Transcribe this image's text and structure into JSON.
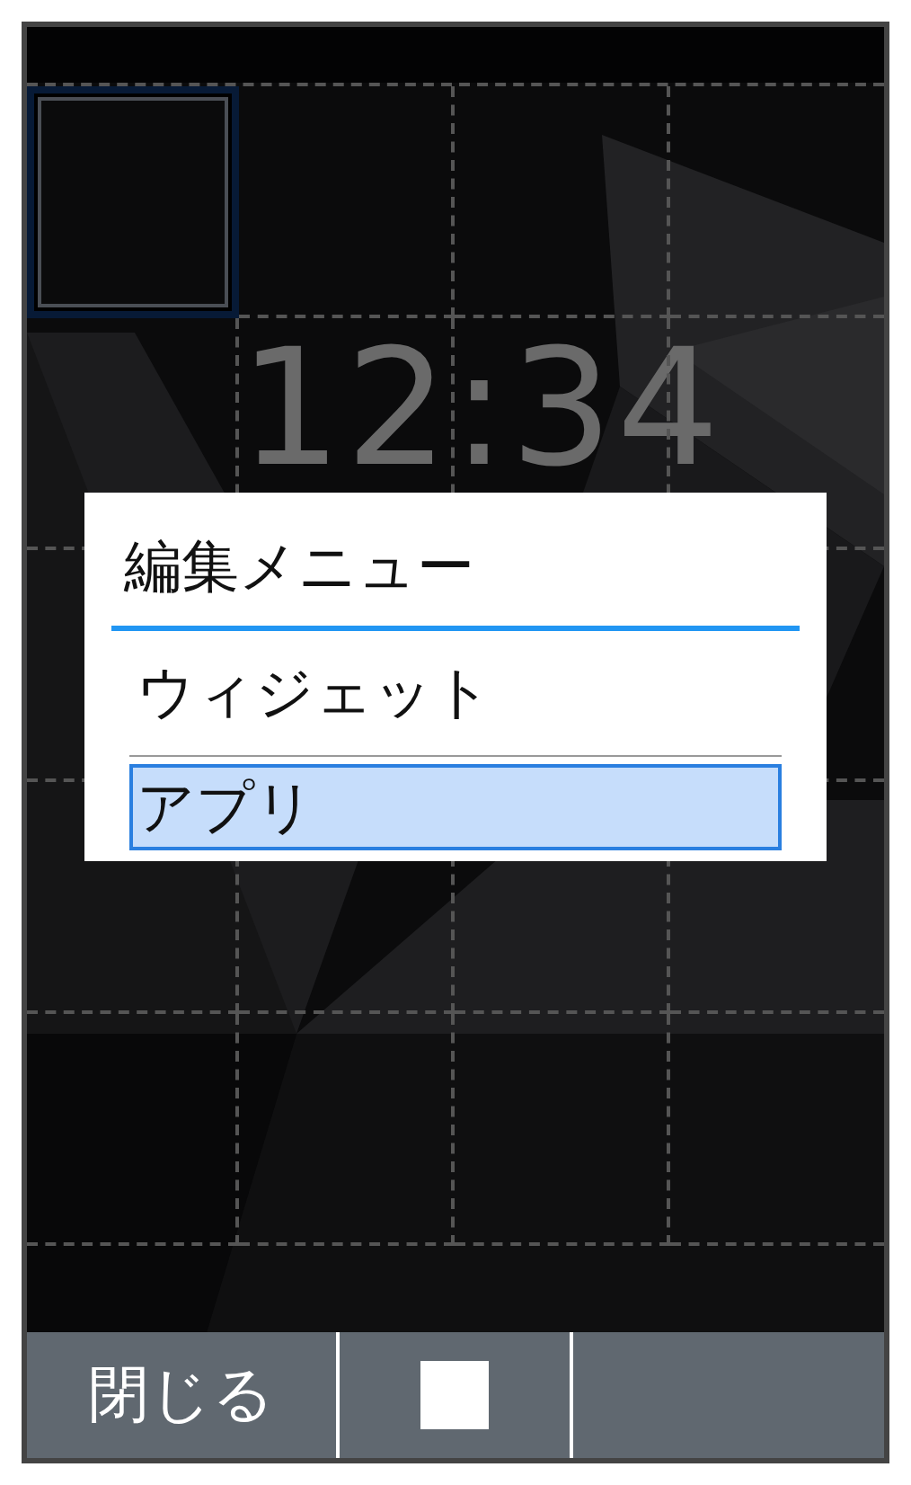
{
  "home_screen": {
    "clock": "12:34",
    "grid_top_row": [
      {
        "selected": true
      },
      {
        "selected": false
      },
      {
        "selected": false
      },
      {
        "selected": false
      }
    ]
  },
  "dialog": {
    "title": "編集メニュー",
    "items": [
      {
        "label": "ウィジェット",
        "selected": false
      },
      {
        "label": "アプリ",
        "selected": true
      }
    ]
  },
  "softkeys": [
    {
      "kind": "text",
      "label": "閉じる"
    },
    {
      "kind": "square"
    },
    {
      "kind": "blank"
    }
  ]
}
